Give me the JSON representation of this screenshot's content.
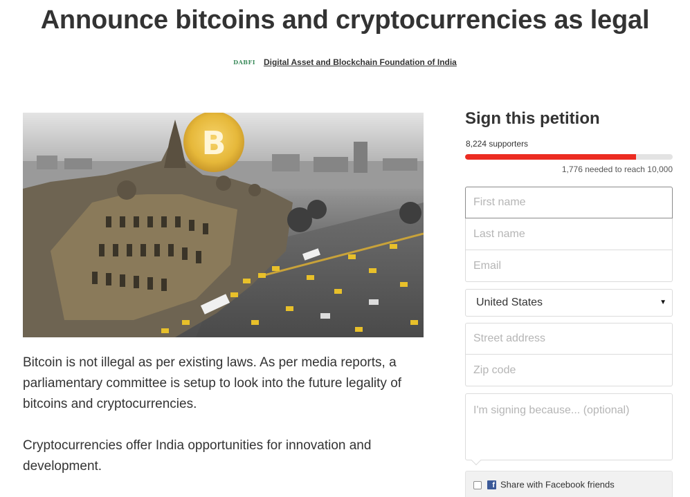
{
  "petition": {
    "title": "Announce bitcoins and cryptocurrencies as legal",
    "organization": {
      "logo_text": "DABFI",
      "name": "Digital Asset and Blockchain Foundation of India"
    },
    "description": [
      "Bitcoin is not illegal as per existing laws. As per media reports, a parliamentary committee is setup to look into the future legality of bitcoins and cryptocurrencies.",
      "Cryptocurrencies offer India opportunities for innovation and development."
    ]
  },
  "sign_panel": {
    "heading": "Sign this petition",
    "supporters_text": "8,224 supporters",
    "needed_text": "1,776 needed to reach 10,000",
    "progress_fraction": 0.8224,
    "progress_color": "#ec2c22",
    "fields": {
      "first_name_placeholder": "First name",
      "last_name_placeholder": "Last name",
      "email_placeholder": "Email",
      "country_selected": "United States",
      "street_placeholder": "Street address",
      "zip_placeholder": "Zip code",
      "reason_placeholder": "I'm signing because... (optional)"
    },
    "share": {
      "label": "Share with Facebook friends",
      "icon": "facebook-icon"
    }
  },
  "hero_image": {
    "icon": "bitcoin-logo"
  }
}
